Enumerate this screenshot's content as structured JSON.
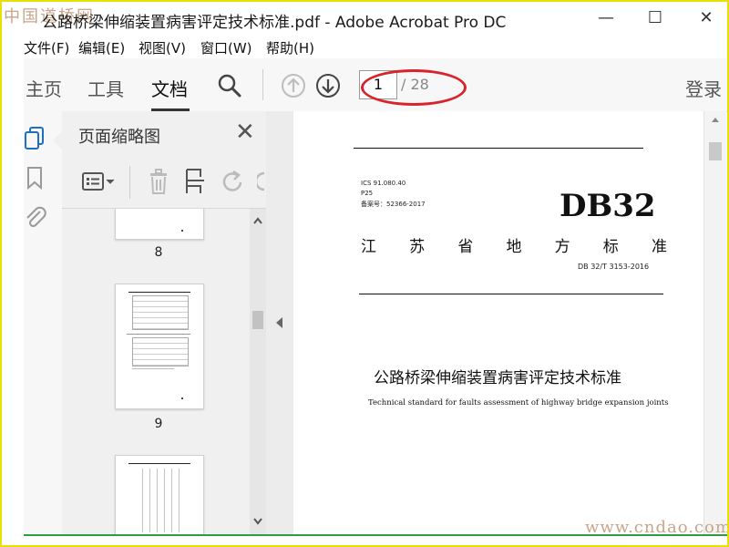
{
  "window": {
    "title": "公路桥梁伸缩装置病害评定技术标准.pdf - Adobe Acrobat Pro DC",
    "watermark_top": "中国道桥网",
    "watermark_bottom": "www.cndao.com",
    "min_icon": "—",
    "max_icon": "☐",
    "close_icon": "✕"
  },
  "menu": [
    "文件(F)",
    "编辑(E)",
    "视图(V)",
    "窗口(W)",
    "帮助(H)"
  ],
  "toolbar": {
    "tabs": [
      "主页",
      "工具",
      "文档"
    ],
    "active_tab": "文档",
    "page_current": "1",
    "page_total": "/ 28",
    "login": "登录"
  },
  "thumbnails": {
    "title": "页面缩略图",
    "close": "✕",
    "pages": [
      "8",
      "9"
    ]
  },
  "document": {
    "ics": "ICS 91.080.40",
    "p": "P25",
    "filing": "备案号：52366-2017",
    "code": "DB32",
    "region": [
      "江",
      "苏",
      "省",
      "地",
      "方",
      "标",
      "准"
    ],
    "std_no": "DB 32/T 3153-2016",
    "title_cn": "公路桥梁伸缩装置病害评定技术标准",
    "title_en": "Technical standard for faults assessment of highway bridge expansion joints"
  },
  "colors": {
    "highlight": "#d9232a",
    "frame": "#e8e000",
    "underline": "#2e9b45"
  }
}
